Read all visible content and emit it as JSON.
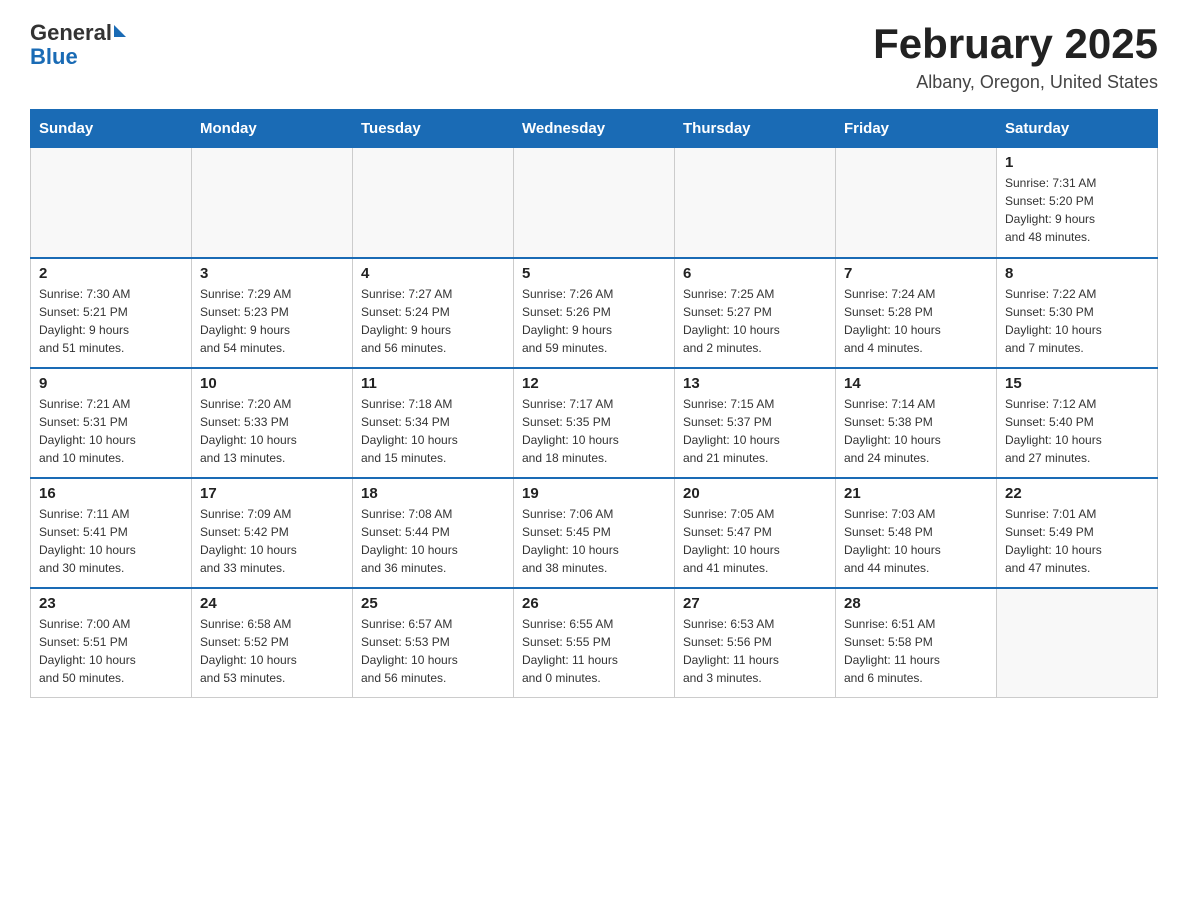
{
  "header": {
    "logo_general": "General",
    "logo_blue": "Blue",
    "title": "February 2025",
    "subtitle": "Albany, Oregon, United States"
  },
  "days_of_week": [
    "Sunday",
    "Monday",
    "Tuesday",
    "Wednesday",
    "Thursday",
    "Friday",
    "Saturday"
  ],
  "weeks": [
    [
      {
        "day": "",
        "info": ""
      },
      {
        "day": "",
        "info": ""
      },
      {
        "day": "",
        "info": ""
      },
      {
        "day": "",
        "info": ""
      },
      {
        "day": "",
        "info": ""
      },
      {
        "day": "",
        "info": ""
      },
      {
        "day": "1",
        "info": "Sunrise: 7:31 AM\nSunset: 5:20 PM\nDaylight: 9 hours\nand 48 minutes."
      }
    ],
    [
      {
        "day": "2",
        "info": "Sunrise: 7:30 AM\nSunset: 5:21 PM\nDaylight: 9 hours\nand 51 minutes."
      },
      {
        "day": "3",
        "info": "Sunrise: 7:29 AM\nSunset: 5:23 PM\nDaylight: 9 hours\nand 54 minutes."
      },
      {
        "day": "4",
        "info": "Sunrise: 7:27 AM\nSunset: 5:24 PM\nDaylight: 9 hours\nand 56 minutes."
      },
      {
        "day": "5",
        "info": "Sunrise: 7:26 AM\nSunset: 5:26 PM\nDaylight: 9 hours\nand 59 minutes."
      },
      {
        "day": "6",
        "info": "Sunrise: 7:25 AM\nSunset: 5:27 PM\nDaylight: 10 hours\nand 2 minutes."
      },
      {
        "day": "7",
        "info": "Sunrise: 7:24 AM\nSunset: 5:28 PM\nDaylight: 10 hours\nand 4 minutes."
      },
      {
        "day": "8",
        "info": "Sunrise: 7:22 AM\nSunset: 5:30 PM\nDaylight: 10 hours\nand 7 minutes."
      }
    ],
    [
      {
        "day": "9",
        "info": "Sunrise: 7:21 AM\nSunset: 5:31 PM\nDaylight: 10 hours\nand 10 minutes."
      },
      {
        "day": "10",
        "info": "Sunrise: 7:20 AM\nSunset: 5:33 PM\nDaylight: 10 hours\nand 13 minutes."
      },
      {
        "day": "11",
        "info": "Sunrise: 7:18 AM\nSunset: 5:34 PM\nDaylight: 10 hours\nand 15 minutes."
      },
      {
        "day": "12",
        "info": "Sunrise: 7:17 AM\nSunset: 5:35 PM\nDaylight: 10 hours\nand 18 minutes."
      },
      {
        "day": "13",
        "info": "Sunrise: 7:15 AM\nSunset: 5:37 PM\nDaylight: 10 hours\nand 21 minutes."
      },
      {
        "day": "14",
        "info": "Sunrise: 7:14 AM\nSunset: 5:38 PM\nDaylight: 10 hours\nand 24 minutes."
      },
      {
        "day": "15",
        "info": "Sunrise: 7:12 AM\nSunset: 5:40 PM\nDaylight: 10 hours\nand 27 minutes."
      }
    ],
    [
      {
        "day": "16",
        "info": "Sunrise: 7:11 AM\nSunset: 5:41 PM\nDaylight: 10 hours\nand 30 minutes."
      },
      {
        "day": "17",
        "info": "Sunrise: 7:09 AM\nSunset: 5:42 PM\nDaylight: 10 hours\nand 33 minutes."
      },
      {
        "day": "18",
        "info": "Sunrise: 7:08 AM\nSunset: 5:44 PM\nDaylight: 10 hours\nand 36 minutes."
      },
      {
        "day": "19",
        "info": "Sunrise: 7:06 AM\nSunset: 5:45 PM\nDaylight: 10 hours\nand 38 minutes."
      },
      {
        "day": "20",
        "info": "Sunrise: 7:05 AM\nSunset: 5:47 PM\nDaylight: 10 hours\nand 41 minutes."
      },
      {
        "day": "21",
        "info": "Sunrise: 7:03 AM\nSunset: 5:48 PM\nDaylight: 10 hours\nand 44 minutes."
      },
      {
        "day": "22",
        "info": "Sunrise: 7:01 AM\nSunset: 5:49 PM\nDaylight: 10 hours\nand 47 minutes."
      }
    ],
    [
      {
        "day": "23",
        "info": "Sunrise: 7:00 AM\nSunset: 5:51 PM\nDaylight: 10 hours\nand 50 minutes."
      },
      {
        "day": "24",
        "info": "Sunrise: 6:58 AM\nSunset: 5:52 PM\nDaylight: 10 hours\nand 53 minutes."
      },
      {
        "day": "25",
        "info": "Sunrise: 6:57 AM\nSunset: 5:53 PM\nDaylight: 10 hours\nand 56 minutes."
      },
      {
        "day": "26",
        "info": "Sunrise: 6:55 AM\nSunset: 5:55 PM\nDaylight: 11 hours\nand 0 minutes."
      },
      {
        "day": "27",
        "info": "Sunrise: 6:53 AM\nSunset: 5:56 PM\nDaylight: 11 hours\nand 3 minutes."
      },
      {
        "day": "28",
        "info": "Sunrise: 6:51 AM\nSunset: 5:58 PM\nDaylight: 11 hours\nand 6 minutes."
      },
      {
        "day": "",
        "info": ""
      }
    ]
  ]
}
